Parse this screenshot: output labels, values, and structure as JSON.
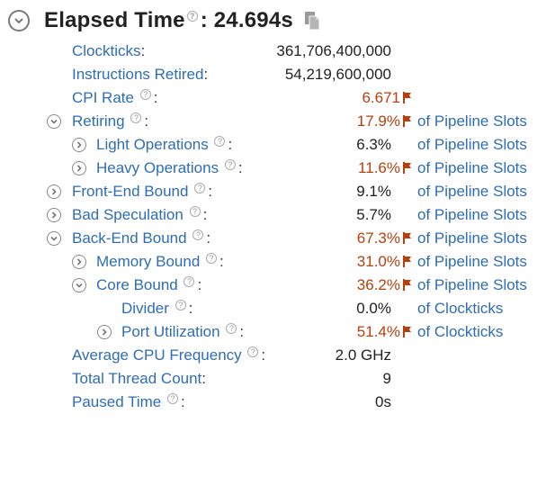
{
  "header": {
    "title": "Elapsed Time",
    "value": ": 24.694s",
    "help": "?"
  },
  "rows": [
    {
      "label": "Clockticks",
      "value": "361,706,400,000"
    },
    {
      "label": "Instructions Retired",
      "value": "54,219,600,000"
    },
    {
      "label": "CPI Rate",
      "value": "6.671"
    },
    {
      "label": "Retiring",
      "value": "17.9%",
      "unit": "of Pipeline Slots"
    },
    {
      "label": "Light Operations",
      "value": "6.3%",
      "unit": "of Pipeline Slots"
    },
    {
      "label": "Heavy Operations",
      "value": "11.6%",
      "unit": "of Pipeline Slots"
    },
    {
      "label": "Front-End Bound",
      "value": "9.1%",
      "unit": "of Pipeline Slots"
    },
    {
      "label": "Bad Speculation",
      "value": "5.7%",
      "unit": "of Pipeline Slots"
    },
    {
      "label": "Back-End Bound",
      "value": "67.3%",
      "unit": "of Pipeline Slots"
    },
    {
      "label": "Memory Bound",
      "value": "31.0%",
      "unit": "of Pipeline Slots"
    },
    {
      "label": "Core Bound",
      "value": "36.2%",
      "unit": "of Pipeline Slots"
    },
    {
      "label": "Divider",
      "value": "0.0%",
      "unit": "of Clockticks"
    },
    {
      "label": "Port Utilization",
      "value": "51.4%",
      "unit": "of Clockticks"
    },
    {
      "label": "Average CPU Frequency",
      "value": "2.0 GHz"
    },
    {
      "label": "Total Thread Count",
      "value": "9"
    },
    {
      "label": "Paused Time",
      "value": "0s"
    }
  ],
  "colors": {
    "link": "#2e6db4",
    "flagged": "#b4400e",
    "text": "#222222"
  }
}
